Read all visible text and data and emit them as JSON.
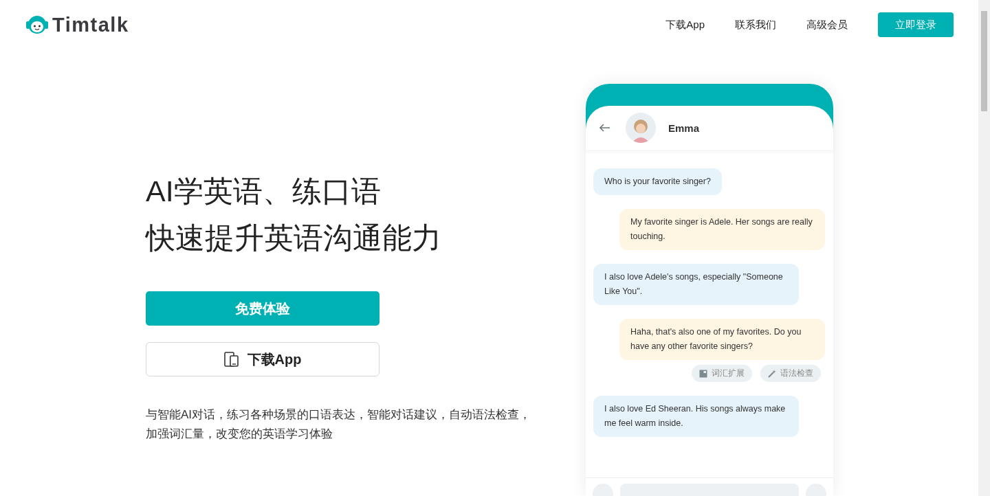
{
  "header": {
    "logo_text": "Timtalk",
    "nav": [
      {
        "label": "下载App",
        "kind": "link"
      },
      {
        "label": "联系我们",
        "kind": "link"
      },
      {
        "label": "高级会员",
        "kind": "link"
      },
      {
        "label": "立即登录",
        "kind": "button"
      }
    ]
  },
  "hero": {
    "title_lines": [
      "AI学英语、练口语",
      "快速提升英语沟通能力"
    ],
    "primary_button": "免费体验",
    "secondary_button": "下载App",
    "description": "与智能AI对话，练习各种场景的口语表达，智能对话建议，自动语法检查，加强词汇量，改变您的英语学习体验"
  },
  "chat": {
    "contact_name": "Emma",
    "messages": [
      {
        "kind": "ai",
        "text": "Who is your favorite singer?"
      },
      {
        "kind": "user",
        "text": "My favorite singer is Adele. Her songs are really touching."
      },
      {
        "kind": "ai",
        "text": "I also love Adele's songs, especially \"Someone Like You\"."
      },
      {
        "kind": "user",
        "text": "Haha, that's also one of my favorites. Do you have any other favorite singers?",
        "chips": [
          {
            "kind": "vocab",
            "label": "词汇扩展"
          },
          {
            "kind": "grammar",
            "label": "语法检查"
          }
        ]
      },
      {
        "kind": "ai",
        "text": "I also love Ed Sheeran. His songs always make me feel warm inside."
      }
    ]
  }
}
